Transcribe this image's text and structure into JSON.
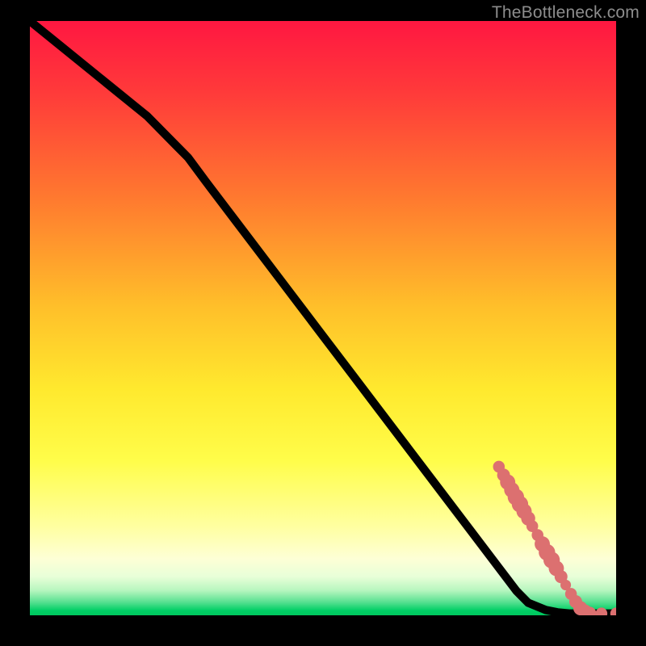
{
  "watermark": "TheBottleneck.com",
  "colors": {
    "black": "#000000",
    "line": "#000000",
    "point": "#dc7070",
    "grad_top": "#ff1a3f",
    "grad_mid1": "#ff9b2a",
    "grad_mid2": "#ffe42c",
    "grad_mid3": "#ffff78",
    "grad_mid4": "#f7ffc0",
    "grad_green": "#00d066"
  },
  "chart_data": {
    "type": "line",
    "title": "",
    "xlabel": "",
    "ylabel": "",
    "xlim": [
      0,
      100
    ],
    "ylim": [
      0,
      100
    ],
    "series": [
      {
        "name": "curve",
        "x": [
          0,
          5,
          10,
          15,
          20,
          25,
          27,
          30,
          35,
          40,
          45,
          50,
          55,
          60,
          65,
          70,
          75,
          80,
          83,
          85,
          88,
          90,
          92,
          94,
          96,
          98,
          100
        ],
        "y": [
          100,
          96,
          92,
          88,
          84,
          79,
          77,
          73,
          66.5,
          60,
          53.5,
          47,
          40.5,
          34,
          27.5,
          21,
          14.5,
          8,
          4.1,
          2.1,
          0.9,
          0.5,
          0.3,
          0.3,
          0.3,
          0.3,
          0.3
        ]
      }
    ],
    "scatter": {
      "name": "points",
      "points": [
        {
          "x": 80.0,
          "y": 25.0,
          "r": 1.0
        },
        {
          "x": 80.8,
          "y": 23.6,
          "r": 1.1
        },
        {
          "x": 81.5,
          "y": 22.4,
          "r": 1.3
        },
        {
          "x": 82.2,
          "y": 21.1,
          "r": 1.3
        },
        {
          "x": 82.9,
          "y": 19.9,
          "r": 1.4
        },
        {
          "x": 83.6,
          "y": 18.7,
          "r": 1.4
        },
        {
          "x": 84.3,
          "y": 17.5,
          "r": 1.3
        },
        {
          "x": 85.0,
          "y": 16.3,
          "r": 1.2
        },
        {
          "x": 85.7,
          "y": 15.0,
          "r": 1.0
        },
        {
          "x": 86.6,
          "y": 13.5,
          "r": 1.0
        },
        {
          "x": 87.4,
          "y": 12.0,
          "r": 1.3
        },
        {
          "x": 88.2,
          "y": 10.6,
          "r": 1.4
        },
        {
          "x": 89.0,
          "y": 9.3,
          "r": 1.4
        },
        {
          "x": 89.8,
          "y": 7.9,
          "r": 1.3
        },
        {
          "x": 90.6,
          "y": 6.5,
          "r": 1.1
        },
        {
          "x": 91.4,
          "y": 5.1,
          "r": 0.9
        },
        {
          "x": 92.3,
          "y": 3.6,
          "r": 1.0
        },
        {
          "x": 93.1,
          "y": 2.3,
          "r": 1.1
        },
        {
          "x": 93.9,
          "y": 1.2,
          "r": 1.2
        },
        {
          "x": 94.7,
          "y": 0.6,
          "r": 1.2
        },
        {
          "x": 95.5,
          "y": 0.35,
          "r": 1.1
        },
        {
          "x": 97.5,
          "y": 0.3,
          "r": 1.0
        },
        {
          "x": 100.0,
          "y": 0.3,
          "r": 1.0
        }
      ]
    },
    "gradient_stops": [
      {
        "offset": 0.0,
        "color": "#ff1741"
      },
      {
        "offset": 0.12,
        "color": "#ff3a3a"
      },
      {
        "offset": 0.3,
        "color": "#ff7a2f"
      },
      {
        "offset": 0.48,
        "color": "#ffbf2a"
      },
      {
        "offset": 0.62,
        "color": "#ffe92e"
      },
      {
        "offset": 0.74,
        "color": "#fffd4a"
      },
      {
        "offset": 0.85,
        "color": "#ffffa0"
      },
      {
        "offset": 0.905,
        "color": "#fdffd6"
      },
      {
        "offset": 0.935,
        "color": "#e8ffd8"
      },
      {
        "offset": 0.958,
        "color": "#b7f6bf"
      },
      {
        "offset": 0.978,
        "color": "#56e090"
      },
      {
        "offset": 0.992,
        "color": "#00cf65"
      },
      {
        "offset": 1.0,
        "color": "#00c75f"
      }
    ]
  }
}
